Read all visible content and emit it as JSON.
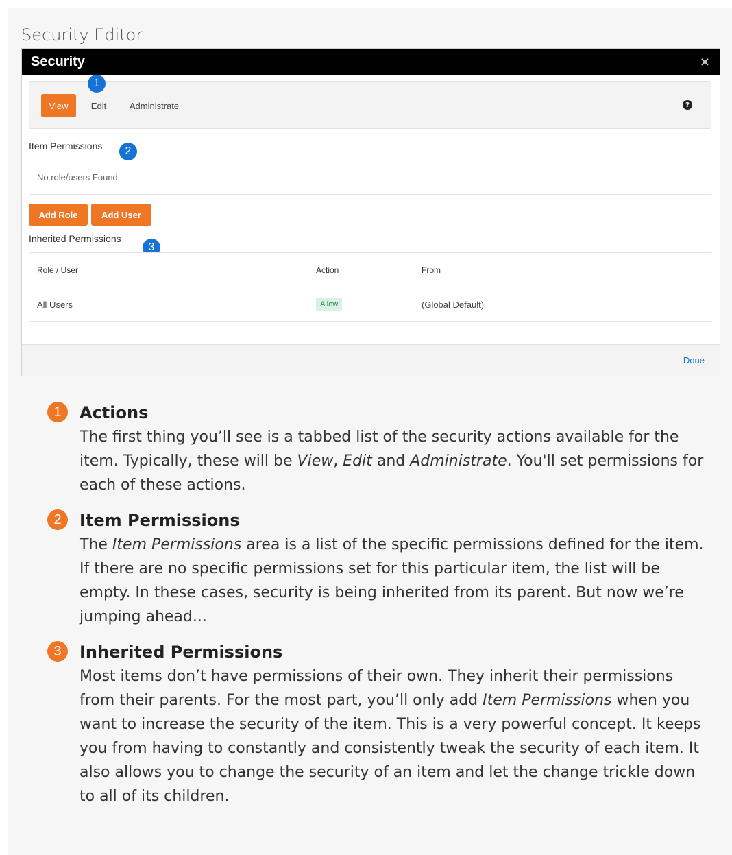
{
  "caption": "Security Editor",
  "modal": {
    "title": "Security",
    "close_glyph": "×",
    "tabs": [
      {
        "label": "View",
        "active": true
      },
      {
        "label": "Edit",
        "active": false
      },
      {
        "label": "Administrate",
        "active": false
      }
    ],
    "help_glyph": "?",
    "item_permissions": {
      "label": "Item Permissions",
      "empty_text": "No role/users Found"
    },
    "buttons": {
      "add_role": "Add Role",
      "add_user": "Add User"
    },
    "inherited_permissions": {
      "label": "Inherited Permissions",
      "columns": [
        "Role / User",
        "Action",
        "From"
      ],
      "rows": [
        {
          "role_user": "All Users",
          "action": "Allow",
          "from": "(Global Default)"
        }
      ]
    },
    "footer": {
      "done_label": "Done"
    }
  },
  "callouts": [
    "1",
    "2",
    "3"
  ],
  "explanations": [
    {
      "number": "1",
      "title": "Actions",
      "body_parts": [
        {
          "text": "The first thing you’ll see is a tabbed list of the security actions available for the item. Typically, these will be "
        },
        {
          "text": "View",
          "italic": true
        },
        {
          "text": ", "
        },
        {
          "text": "Edit",
          "italic": true
        },
        {
          "text": " and "
        },
        {
          "text": "Administrate",
          "italic": true
        },
        {
          "text": ". You'll set permissions for each of these actions."
        }
      ]
    },
    {
      "number": "2",
      "title": "Item Permissions",
      "body_parts": [
        {
          "text": "The "
        },
        {
          "text": "Item Permissions",
          "italic": true
        },
        {
          "text": " area is a list of the specific permissions defined for the item. If there are no specific permissions set for this particular item, the list will be empty. In these cases, security is being inherited from its parent. But now we’re jumping ahead..."
        }
      ]
    },
    {
      "number": "3",
      "title": "Inherited Permissions",
      "body_parts": [
        {
          "text": "Most items don’t have permissions of their own. They inherit their permissions from their parents. For the most part, you’ll only add "
        },
        {
          "text": "Item Permissions",
          "italic": true
        },
        {
          "text": " when you want to increase the security of the item. This is a very powerful concept. It keeps you from having to constantly and consistently tweak the security of each item. It also allows you to change the security of an item and let the change trickle down to all of its children."
        }
      ]
    }
  ],
  "colors": {
    "accent_orange": "#ee7624",
    "callout_blue": "#1673d6",
    "header_black": "#000000",
    "allow_bg": "#d9f2e3",
    "allow_text": "#2d8c53"
  }
}
